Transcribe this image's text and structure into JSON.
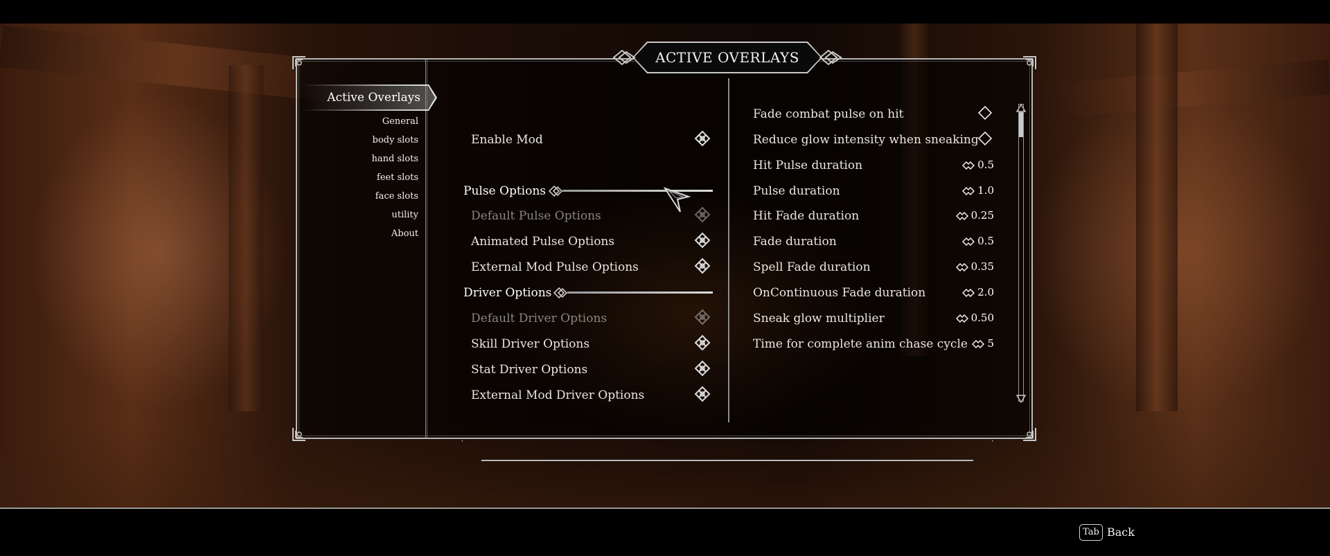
{
  "window": {
    "title": "ACTIVE OVERLAYS"
  },
  "sidebar": {
    "active": "Active Overlays",
    "items": [
      "General",
      "body slots",
      "hand slots",
      "feet slots",
      "face slots",
      "utility",
      "About"
    ]
  },
  "main": {
    "enable_mod": "Enable Mod",
    "pulse_header": "Pulse Options",
    "pulse_items": [
      "Default Pulse Options",
      "Animated Pulse Options",
      "External Mod Pulse Options"
    ],
    "driver_header": "Driver Options",
    "driver_items": [
      "Default Driver Options",
      "Skill Driver Options",
      "Stat Driver Options",
      "External Mod Driver Options"
    ]
  },
  "settings": {
    "toggles": [
      {
        "label": "Fade combat pulse on hit",
        "checked": false
      },
      {
        "label": "Reduce glow intensity when sneaking",
        "checked": false
      }
    ],
    "sliders": [
      {
        "label": "Hit Pulse duration",
        "value": "0.5"
      },
      {
        "label": "Pulse duration",
        "value": "1.0"
      },
      {
        "label": "Hit Fade duration",
        "value": "0.25"
      },
      {
        "label": "Fade duration",
        "value": "0.5"
      },
      {
        "label": "Spell Fade duration",
        "value": "0.35"
      },
      {
        "label": "OnContinuous Fade duration",
        "value": "2.0"
      },
      {
        "label": "Sneak glow multiplier",
        "value": "0.50"
      },
      {
        "label": "Time for complete anim chase cycle",
        "value": "5"
      }
    ]
  },
  "footer": {
    "key": "Tab",
    "label": "Back"
  },
  "icons": {
    "option_icon": "celtic-knot-icon",
    "toggle_icon": "diamond-checkbox-icon",
    "slider_icon": "slider-arrows-icon"
  },
  "colors": {
    "frame": "#b9b9b9",
    "text": "#ebe7df",
    "dim_text": "#8a8680",
    "panel": "#000000"
  }
}
